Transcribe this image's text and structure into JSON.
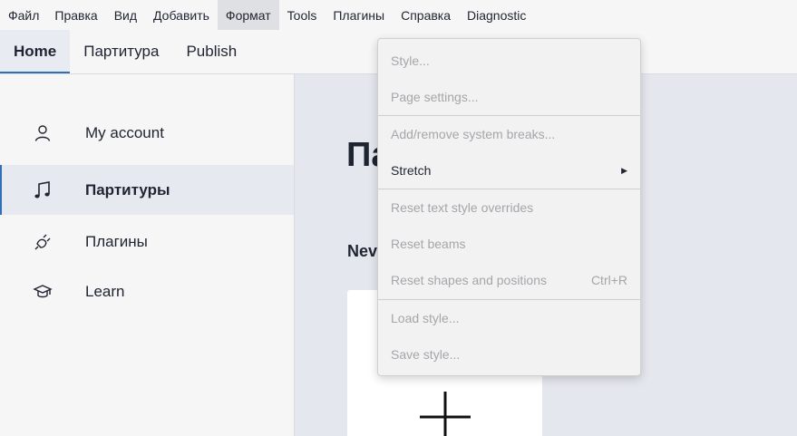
{
  "menubar": {
    "items": [
      "Файл",
      "Правка",
      "Вид",
      "Добавить",
      "Формат",
      "Tools",
      "Плагины",
      "Справка",
      "Diagnostic"
    ],
    "active_index": 4
  },
  "tabs": {
    "items": [
      "Home",
      "Партитура",
      "Publish"
    ],
    "active_index": 0
  },
  "sidebar": {
    "items": [
      {
        "label": "My account",
        "icon": "user-icon"
      },
      {
        "label": "Партитуры",
        "icon": "music-note-icon"
      },
      {
        "label": "Плагины",
        "icon": "plug-icon"
      },
      {
        "label": "Learn",
        "icon": "graduation-cap-icon"
      }
    ],
    "active_index": 1
  },
  "main": {
    "title": "Па",
    "subtitle": "Nev"
  },
  "format_menu": {
    "items": [
      {
        "label": "Style...",
        "enabled": false,
        "shortcut": ""
      },
      {
        "label": "Page settings...",
        "enabled": false,
        "shortcut": ""
      },
      {
        "label": "Add/remove system breaks...",
        "enabled": false,
        "shortcut": ""
      },
      {
        "label": "Stretch",
        "enabled": true,
        "shortcut": "",
        "submenu": true
      },
      {
        "label": "Reset text style overrides",
        "enabled": false,
        "shortcut": ""
      },
      {
        "label": "Reset beams",
        "enabled": false,
        "shortcut": ""
      },
      {
        "label": "Reset shapes and positions",
        "enabled": false,
        "shortcut": "Ctrl+R"
      },
      {
        "label": "Load style...",
        "enabled": false,
        "shortcut": ""
      },
      {
        "label": "Save style...",
        "enabled": false,
        "shortcut": ""
      }
    ]
  },
  "colors": {
    "accent": "#2f6fb3",
    "disabled_text": "#a4a6aa",
    "text": "#1f2431"
  }
}
